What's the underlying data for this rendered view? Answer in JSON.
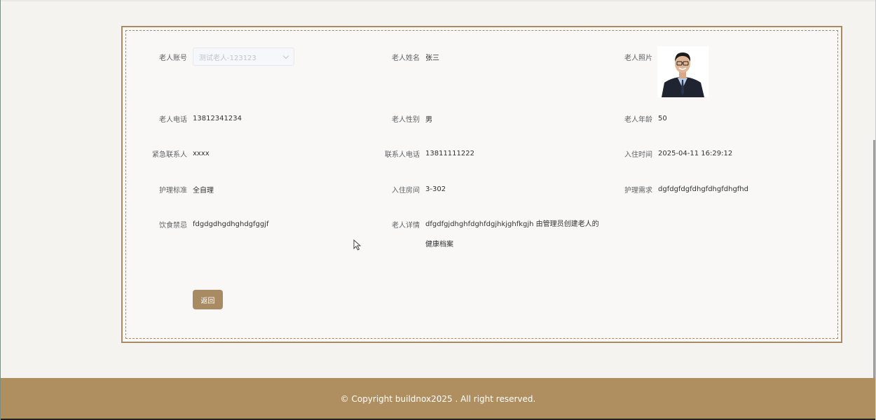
{
  "form": {
    "account": {
      "label": "老人账号",
      "value": "测试老人-123123"
    },
    "name": {
      "label": "老人姓名",
      "value": "张三"
    },
    "photo": {
      "label": "老人照片"
    },
    "phone": {
      "label": "老人电话",
      "value": "13812341234"
    },
    "gender": {
      "label": "老人性别",
      "value": "男"
    },
    "age": {
      "label": "老人年龄",
      "value": "50"
    },
    "contact": {
      "label": "紧急联系人",
      "value": "xxxx"
    },
    "contact_phone": {
      "label": "联系人电话",
      "value": "13811111222"
    },
    "checkin_time": {
      "label": "入住时间",
      "value": "2025-04-11 16:29:12"
    },
    "care_standard": {
      "label": "护理标准",
      "value": "全自理"
    },
    "room": {
      "label": "入住房间",
      "value": "3-302"
    },
    "care_needs": {
      "label": "护理需求",
      "value": "dgfdgfdgfdhgfdhgfdhgfhd"
    },
    "diet": {
      "label": "饮食禁忌",
      "value": "fdgdgdhgdhghdgfggjf"
    },
    "details": {
      "label": "老人详情",
      "value": "dfgdfgjdhghfdghfdgjhkjghfkgjh 由管理员创建老人的健康档案"
    }
  },
  "buttons": {
    "back": "返回"
  },
  "footer": {
    "copyright": "© Copyright buildnox2025 . All right reserved."
  },
  "colors": {
    "accent": "#af8e5f",
    "panel_border": "#a88a63"
  }
}
